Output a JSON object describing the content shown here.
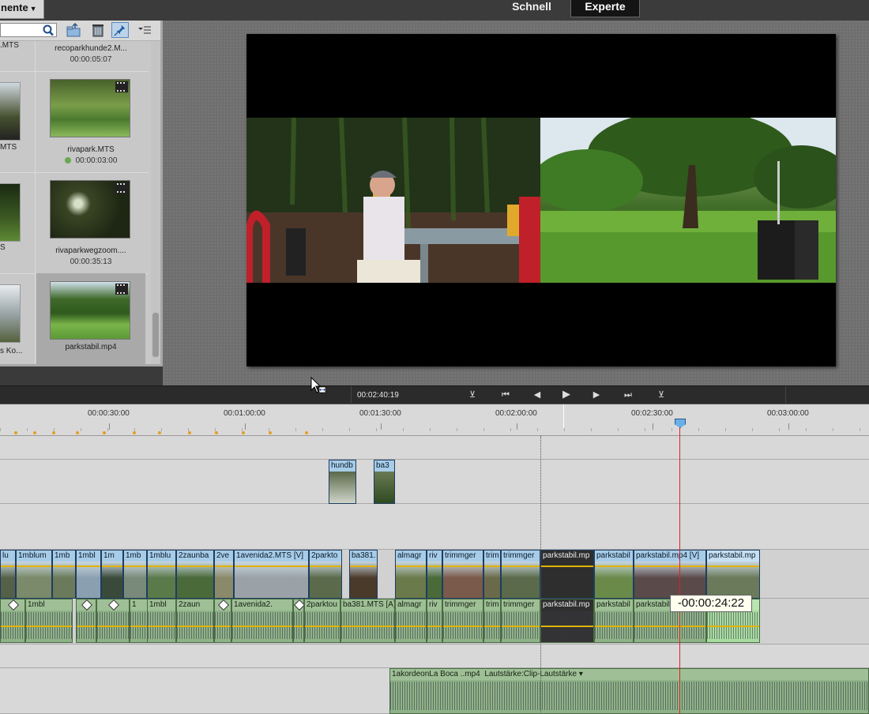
{
  "topbar": {
    "media_dropdown_label": "nente",
    "mode_schnell": "Schnell",
    "mode_experte": "Experte"
  },
  "media_panel": {
    "left_column": [
      {
        "name": ".MTS",
        "duration": ""
      },
      {
        "name": "MTS",
        "duration": ""
      },
      {
        "name": "S",
        "duration": ""
      },
      {
        "name": "s Ko...",
        "duration": ""
      }
    ],
    "items": [
      {
        "name": "recoparkhunde2.M...",
        "duration": "00:00:05:07"
      },
      {
        "name": "rivapark.MTS",
        "duration": "00:00:03:00",
        "offline_dot": true
      },
      {
        "name": "rivaparkwegzoom....",
        "duration": "00:00:35:13"
      },
      {
        "name": "parkstabil.mp4",
        "duration": ""
      }
    ]
  },
  "transport": {
    "timecode": "00:02:40:19"
  },
  "ruler": {
    "labels": [
      "00:00:30:00",
      "00:01:00:00",
      "00:01:30:00",
      "00:02:00:00",
      "00:02:30:00",
      "00:03:00:00"
    ]
  },
  "timeline": {
    "overlay_clips": [
      "hundb",
      "ba3"
    ],
    "video_clips": [
      "lu",
      "1mblum",
      "1mb",
      "1mbl",
      "1m",
      "1mb",
      "1mblu",
      "2zaunba",
      "2ve",
      "1avenida2.MTS [V]",
      "2parkto",
      "ba381.",
      "almagr",
      "riv",
      "trimmger",
      "trim",
      "trimmger",
      "parkstabil.mp",
      "parkstabil",
      "parkstabil.mp4 [V]",
      "parkstabil.mp"
    ],
    "audio_clips": [
      "1mbl",
      "1",
      "1mbl",
      "2zaun",
      "1avenida2.",
      "2parktou",
      "ba381.MTS [A]",
      "almagr",
      "riv",
      "trimmger",
      "trim",
      "trimmger",
      "parkstabil.mp",
      "parkstabil",
      "parkstabil."
    ],
    "music_clip_label": "1akordeonLa Boca ..mp4",
    "music_volume_label": "Lautstärke:Clip-Lautstärke ▾",
    "tooltip": "-00:00:24:22"
  },
  "colors": {
    "video_header": "#a7cce8",
    "audio_clip": "#8fb388",
    "playhead": "#e02020",
    "accent_gold": "#e2b300"
  }
}
